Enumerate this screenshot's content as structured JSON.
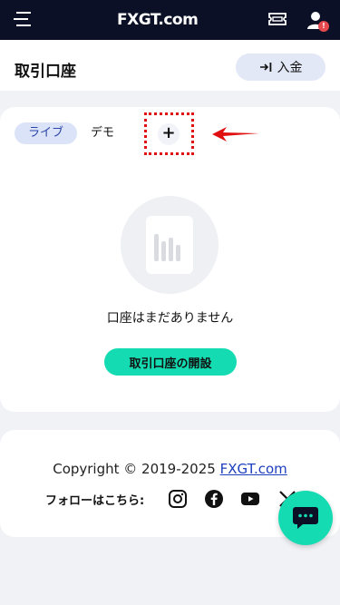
{
  "topbar": {
    "logo": "FXGT.com",
    "user_badge": "!"
  },
  "header": {
    "title": "取引口座",
    "deposit_label": "入金"
  },
  "accounts": {
    "tabs": [
      {
        "label": "ライブ",
        "selected": true
      },
      {
        "label": "デモ",
        "selected": false
      }
    ],
    "add_label": "+",
    "empty_text": "口座はまだありません",
    "open_account_label": "取引口座の開設"
  },
  "footer": {
    "copyright_prefix": "Copyright © 2019-2025 ",
    "copyright_link": "FXGT.com",
    "follow_label": "フォローはこちら:",
    "social": [
      "instagram-icon",
      "facebook-icon",
      "youtube-icon",
      "x-icon"
    ]
  },
  "colors": {
    "topbar_bg": "#0b1026",
    "accent": "#14dbb2",
    "tab_live_bg": "#dbe3f8",
    "deposit_bg": "#e3e8f6",
    "link": "#1d3fbf",
    "annotation_red": "#e01010"
  }
}
